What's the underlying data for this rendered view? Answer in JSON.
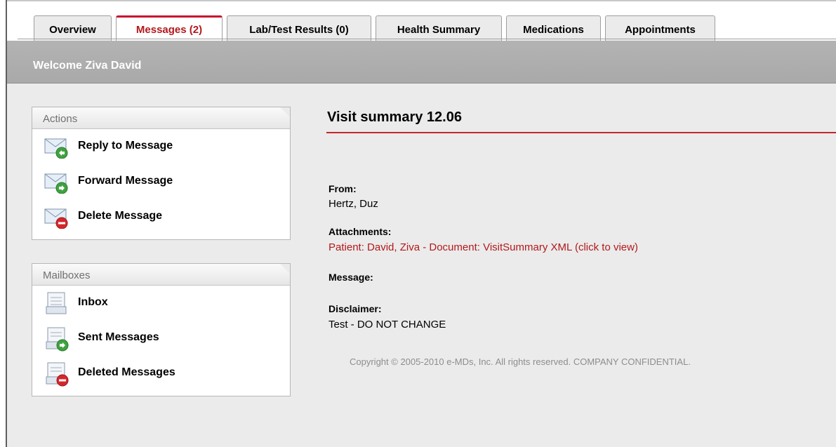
{
  "tabs": [
    {
      "label": "Overview",
      "active": false
    },
    {
      "label": "Messages (2)",
      "active": true
    },
    {
      "label": "Lab/Test Results (0)",
      "active": false
    },
    {
      "label": "Health Summary",
      "active": false
    },
    {
      "label": "Medications",
      "active": false
    },
    {
      "label": "Appointments",
      "active": false
    }
  ],
  "header": {
    "welcome": "Welcome Ziva David"
  },
  "actions_panel": {
    "title": "Actions",
    "items": [
      {
        "label": "Reply to Message",
        "icon": "envelope-reply-icon"
      },
      {
        "label": "Forward Message",
        "icon": "envelope-forward-icon"
      },
      {
        "label": "Delete Message",
        "icon": "envelope-delete-icon"
      }
    ]
  },
  "mailboxes_panel": {
    "title": "Mailboxes",
    "items": [
      {
        "label": "Inbox",
        "icon": "inbox-icon"
      },
      {
        "label": "Sent Messages",
        "icon": "sent-icon"
      },
      {
        "label": "Deleted Messages",
        "icon": "deleted-icon"
      }
    ]
  },
  "message": {
    "title": "Visit summary 12.06",
    "from_label": "From:",
    "from_value": "Hertz, Duz",
    "attachments_label": "Attachments:",
    "attachment_link": "Patient: David, Ziva - Document: VisitSummary XML (click to view)",
    "message_label": "Message:",
    "disclaimer_label": "Disclaimer:",
    "disclaimer_value": "Test - DO NOT CHANGE"
  },
  "footer": {
    "copyright": "Copyright © 2005-2010 e-MDs, Inc. All rights reserved. COMPANY CONFIDENTIAL."
  },
  "colors": {
    "accent": "#c8102e",
    "active_tab_text": "#b3181c",
    "header_bar": "#aaaaaa",
    "content_bg": "#ebebeb"
  }
}
